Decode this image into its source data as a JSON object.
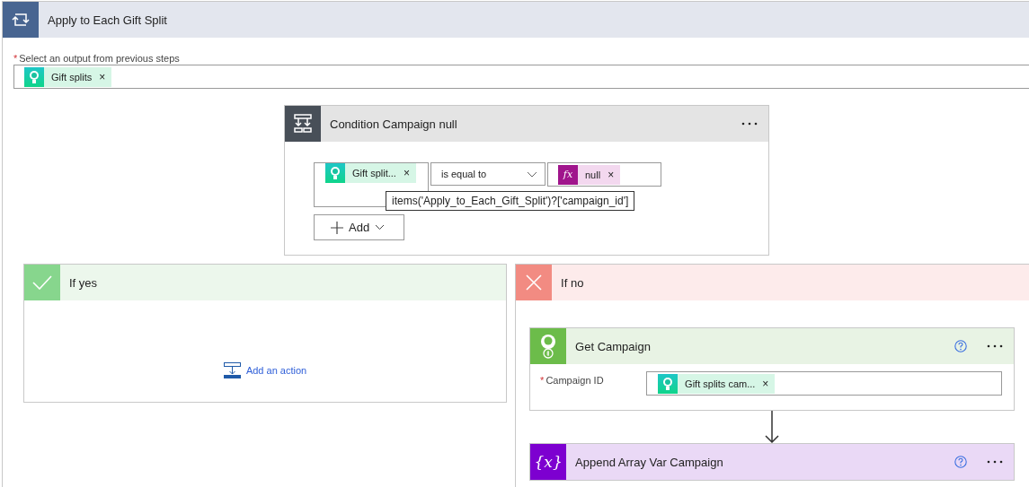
{
  "loop": {
    "title": "Apply to Each Gift Split",
    "output_label": "Select an output from previous steps",
    "required": true,
    "required_mark": "*",
    "tokens": [
      {
        "label": "Gift splits",
        "remove": "×",
        "kind": "dynamic"
      }
    ]
  },
  "condition": {
    "title": "Condition Campaign null",
    "left_tokens": [
      {
        "label": "Gift split...",
        "remove": "×",
        "kind": "dynamic"
      }
    ],
    "operator": "is equal to",
    "right_tokens": [
      {
        "label": "null",
        "remove": "×",
        "kind": "expression",
        "icon_text": "fx"
      }
    ],
    "tooltip": "items('Apply_to_Each_Gift_Split')?['campaign_id']",
    "add_button": "Add"
  },
  "branches": [
    {
      "kind": "yes",
      "title": "If yes",
      "add_action": "Add an action"
    },
    {
      "kind": "no",
      "title": "If no",
      "actions": [
        {
          "kind": "connector",
          "title": "Get Campaign",
          "fields": [
            {
              "label": "Campaign ID",
              "required": true,
              "required_mark": "*",
              "tokens": [
                {
                  "label": "Gift splits cam...",
                  "remove": "×",
                  "kind": "dynamic"
                }
              ]
            }
          ]
        },
        {
          "kind": "variable",
          "title": "Append Array Var Campaign",
          "icon_text": "{x}"
        }
      ]
    }
  ]
}
